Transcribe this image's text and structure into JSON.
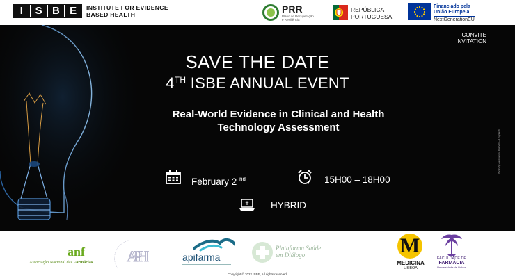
{
  "header": {
    "isbe_letters": [
      "I",
      "S",
      "B",
      "E"
    ],
    "isbe_subtitle_line1": "INSTITUTE FOR EVIDENCE",
    "isbe_subtitle_line2": "BASED HEALTH",
    "prr_title": "PRR",
    "prr_small_line1": "Plano de Recuperação",
    "prr_small_line2": "e Resiliência",
    "rp_line1": "REPÚBLICA",
    "rp_line2": "PORTUGUESA",
    "eu_line1": "Financiado pela",
    "eu_line2": "União Europeia",
    "eu_line3": "NextGenerationEU"
  },
  "hero": {
    "convite": "CONVITE",
    "invitation": "INVITATION",
    "save_the_date": "SAVE THE DATE",
    "event_number": "4",
    "event_suffix": "TH",
    "event_name": "ISBE ANNUAL EVENT",
    "subtitle_line1": "Real-World Evidence in Clinical and Health",
    "subtitle_line2": "Technology Assessment",
    "date_label": "February 2",
    "date_suffix": "nd",
    "time_label": "15H00 – 18H00",
    "mode_label": "HYBRID",
    "photo_credit": "Photo by Alessandro Bianchi – Unsplash"
  },
  "footer": {
    "anf_logo": "anf",
    "anf_name_1": "Associação Nacional das ",
    "anf_name_2": "Farmácias",
    "aph_logo": "APH",
    "apifarma": "apifarma",
    "plataforma_line1": "Plataforma Saúde",
    "plataforma_line2": "em Diálogo",
    "medicina_letter": "M",
    "medicina": "MEDICINA",
    "medicina_lisboa": "LISBOA",
    "farmacia_line1": "FACULDADE DE",
    "farmacia_line2": "FARMÁCIA",
    "farmacia_line3": "Universidade de Lisboa",
    "copyright": "Copyright © 2022 ISBE, All rights reserved."
  },
  "colors": {
    "hero_bg": "#060606",
    "eu_blue": "#003399",
    "eu_star": "#ffcc00",
    "prr_green": "#2e7d32",
    "anf_green": "#6aaa1f",
    "medicina_yellow": "#f5c400",
    "farmacia_purple": "#6b3fa0",
    "bulb_blue": "#3a8ad8"
  },
  "icons": [
    "calendar-icon",
    "alarm-clock-icon",
    "laptop-icon",
    "lightbulb-image",
    "eu-flag-icon",
    "portugal-shield-icon"
  ]
}
